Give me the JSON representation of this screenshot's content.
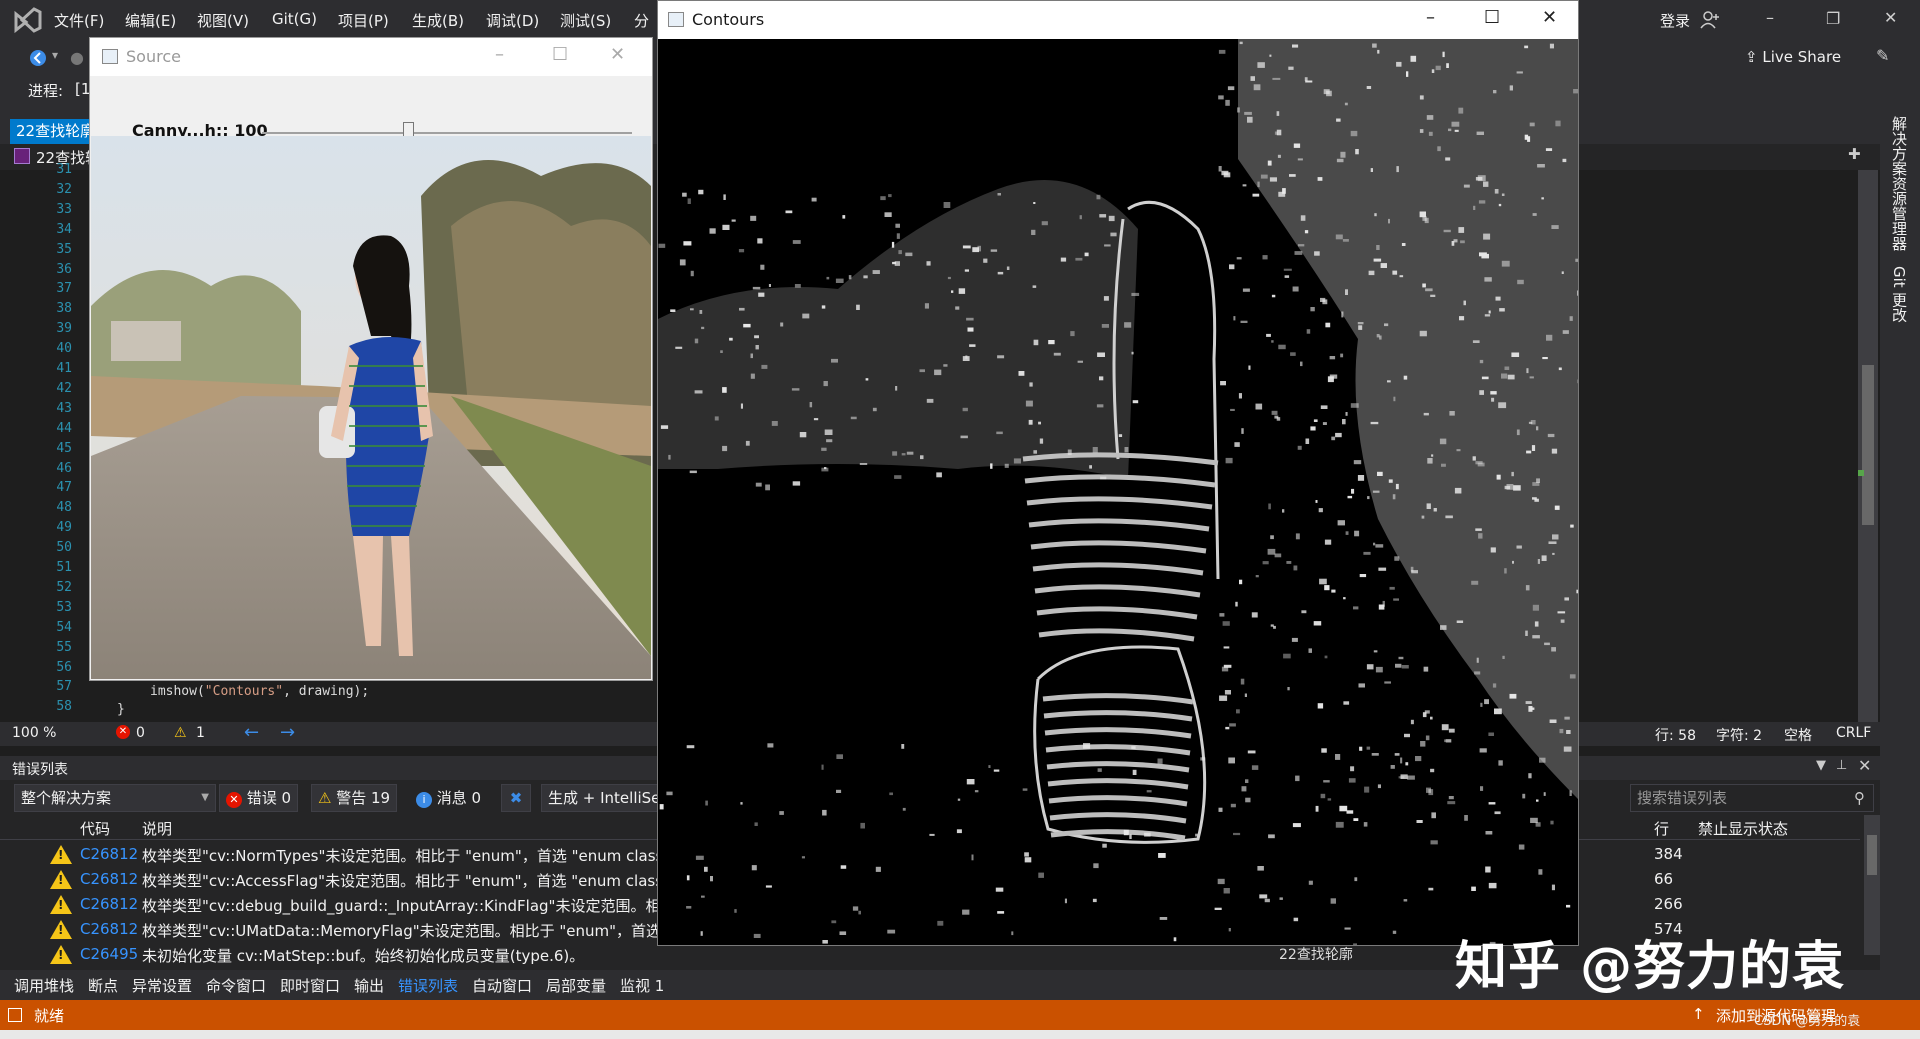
{
  "menubar": {
    "items": [
      "文件(F)",
      "编辑(E)",
      "视图(V)",
      "Git(G)",
      "项目(P)",
      "生成(B)",
      "调试(D)",
      "测试(S)",
      "分"
    ],
    "login": "登录",
    "live_share": "Live Share"
  },
  "toolbar": {
    "process_label": "进程:",
    "process_value": "[1"
  },
  "tabs": {
    "active_tab": "22查找轮廓",
    "nav_file": "22查找轮"
  },
  "editor": {
    "line_numbers": [
      "31",
      "32",
      "33",
      "34",
      "35",
      "36",
      "37",
      "38",
      "39",
      "40",
      "41",
      "42",
      "43",
      "44",
      "45",
      "46",
      "47",
      "48",
      "49",
      "50",
      "51",
      "52",
      "53",
      "54",
      "55",
      "56",
      "57",
      "58"
    ],
    "code_prefix": "imshow(",
    "code_string": "\"Contours\"",
    "code_suffix": ", drawing);",
    "code_brace": "}",
    "zoom": "100 %",
    "errors": "0",
    "warnings": "1",
    "line": "行: 58",
    "char": "字符: 2",
    "space": "空格",
    "eol": "CRLF"
  },
  "error_list": {
    "title": "错误列表",
    "scope": "整个解决方案",
    "errors_btn": "错误 0",
    "warnings_btn": "警告 19",
    "messages_btn": "消息 0",
    "build_filter": "生成 + IntelliSe",
    "search_placeholder": "搜索错误列表",
    "col_code": "代码",
    "col_desc": "说明",
    "col_line": "行",
    "col_suppress": "禁止显示状态",
    "rows": [
      {
        "code": "C26812",
        "desc": "枚举类型\"cv::NormTypes\"未设定范围。相比于 \"enum\"，首选 \"enum class",
        "line": "384"
      },
      {
        "code": "C26812",
        "desc": "枚举类型\"cv::AccessFlag\"未设定范围。相比于 \"enum\"，首选 \"enum class\"",
        "line": "66"
      },
      {
        "code": "C26812",
        "desc": "枚举类型\"cv::debug_build_guard::_InputArray::KindFlag\"未设定范围。相比",
        "line": "266"
      },
      {
        "code": "C26812",
        "desc": "枚举类型\"cv::UMatData::MemoryFlag\"未设定范围。相比于 \"enum\"，首选",
        "line": "574"
      },
      {
        "code": "C26495",
        "desc": "未初始化变量 cv::MatStep::buf。始终初始化成员变量(type.6)。",
        "line": ""
      }
    ]
  },
  "bottom_tabs": [
    "调用堆栈",
    "断点",
    "异常设置",
    "命令窗口",
    "即时窗口",
    "输出",
    "错误列表",
    "自动窗口",
    "局部变量",
    "监视 1"
  ],
  "status": {
    "ready": "就绪",
    "add_source": "添加到源代码管理"
  },
  "side_panel": {
    "solution_explorer": "解决方案资源管理器",
    "git_changes": "Git 更改"
  },
  "source_window": {
    "title": "Source",
    "trackbar_label": "Canny...h:: 100",
    "trackbar_value": 100,
    "trackbar_max": 255
  },
  "contours_window": {
    "title": "Contours",
    "caption": "22查找轮廓"
  },
  "watermark": {
    "text": "知乎 @努力的袁",
    "small": "CSDN @努力的袁"
  },
  "colors": {
    "vs_dark": "#1e1e1e",
    "vs_accent": "#007acc",
    "status_orange": "#ca5100",
    "warning_yellow": "#f5c518",
    "error_red": "#e51400"
  }
}
